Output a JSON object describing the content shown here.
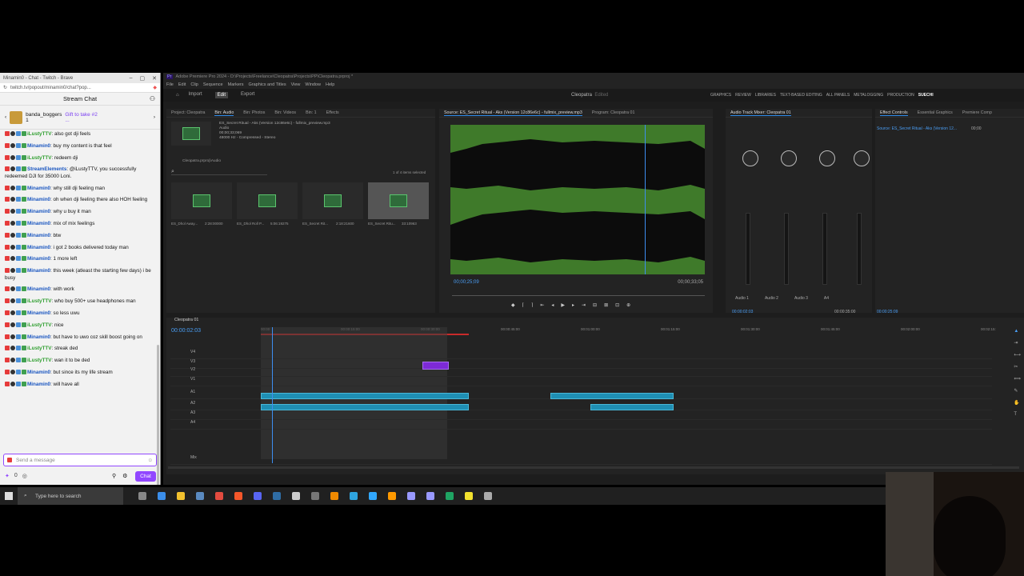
{
  "browser": {
    "tab_title": "Minamin0 - Chat - Twitch - Brave",
    "url": "twitch.tv/popout/minamin0/chat?pop..."
  },
  "chat": {
    "header": "Stream Chat",
    "banner": {
      "user": "banda_boggers",
      "count": "1",
      "gift": "Gift to take #2",
      "dots": "..."
    },
    "messages": [
      {
        "user": "iLustyTTV",
        "color": "#2e9e2e",
        "text": "also got dji feels"
      },
      {
        "user": "Minamin0",
        "color": "#1a56c0",
        "text": "buy my content is that feel"
      },
      {
        "user": "iLustyTTV",
        "color": "#2e9e2e",
        "text": "redeem dji"
      },
      {
        "user": "StreamElements",
        "color": "#1a56c0",
        "text": "@iLustyTTV, you successfully redeemed DJI for 35000 Loni."
      },
      {
        "user": "Minamin0",
        "color": "#1a56c0",
        "text": "why still dji feeling man"
      },
      {
        "user": "Minamin0",
        "color": "#1a56c0",
        "text": "oh when dji feeling there also HOH feeling"
      },
      {
        "user": "Minamin0",
        "color": "#1a56c0",
        "text": "why u buy it man"
      },
      {
        "user": "Minamin0",
        "color": "#1a56c0",
        "text": "mix of mix feelings"
      },
      {
        "user": "Minamin0",
        "color": "#1a56c0",
        "text": "btw"
      },
      {
        "user": "Minamin0",
        "color": "#1a56c0",
        "text": "i got 2 books delivered today man"
      },
      {
        "user": "Minamin0",
        "color": "#1a56c0",
        "text": "1 more left"
      },
      {
        "user": "Minamin0",
        "color": "#1a56c0",
        "text": "this week (atleast the starting few days) i be busy"
      },
      {
        "user": "Minamin0",
        "color": "#1a56c0",
        "text": "with work"
      },
      {
        "user": "iLustyTTV",
        "color": "#2e9e2e",
        "text": "who buy 500+ use headphones man"
      },
      {
        "user": "Minamin0",
        "color": "#1a56c0",
        "text": "so less uwu"
      },
      {
        "user": "iLustyTTV",
        "color": "#2e9e2e",
        "text": "nice"
      },
      {
        "user": "Minamin0",
        "color": "#1a56c0",
        "text": "but have to uwo coz skill boost going on"
      },
      {
        "user": "iLustyTTV",
        "color": "#2e9e2e",
        "text": "streak ded"
      },
      {
        "user": "iLustyTTV",
        "color": "#2e9e2e",
        "text": "wan it to be ded"
      },
      {
        "user": "Minamin0",
        "color": "#1a56c0",
        "text": "but since its my life stream"
      },
      {
        "user": "Minamin0",
        "color": "#1a56c0",
        "text": "will have all"
      }
    ],
    "input_placeholder": "Send a message",
    "points": "0",
    "chat_button": "Chat"
  },
  "premiere": {
    "title": "Adobe Premiere Pro 2024 - D:\\Projects\\Freelance\\Cleopatra\\Projects\\PP\\Cleopatra.prproj *",
    "menu": [
      "File",
      "Edit",
      "Clip",
      "Sequence",
      "Markers",
      "Graphics and Titles",
      "View",
      "Window",
      "Help"
    ],
    "tabs": [
      "Import",
      "Edit",
      "Export"
    ],
    "center_title": "Cleopatra",
    "center_sub": "Edited",
    "workspaces": [
      "GRAPHICS",
      "REVIEW",
      "LIBRARIES",
      "TEXT-BASED EDITING",
      "ALL PANELS",
      "METALOGGING",
      "PRODUCTION",
      "SUECHI"
    ],
    "project": {
      "tabs": [
        "Project: Cleopatra",
        "Bin: Audio",
        "Bin: Photos",
        "Bin: Videos",
        "Bin: 1",
        "Effects"
      ],
      "preview_name": "ES_Secret Ritual - Aks (Version 12c86e6c) - fullmix_preview.mp3",
      "preview_type": "Audio",
      "preview_dur": "00;00;33;069",
      "preview_rate": "48000 Hz - Compressed - Stereo",
      "path": "Cleopatra.prproj\\Audio",
      "selected": "1 of 4 items selected",
      "items": [
        {
          "name": "ES_Dhol Away...",
          "dur": "2:28:00000"
        },
        {
          "name": "ES_Dhol Roll P...",
          "dur": "5:06:19275"
        },
        {
          "name": "ES_Secret Rit...",
          "dur": "2:18:21600"
        },
        {
          "name": "ES_Secret Ritu...",
          "dur": "33:10963"
        }
      ]
    },
    "source": {
      "tab": "Source: ES_Secret Ritual - Aks (Version 12c86e6c) - fullmix_preview.mp3",
      "program": "Program: Cleopatra 01",
      "tc_left": "00;00;25;09",
      "tc_right": "00;00;33;05"
    },
    "mixer": {
      "tab": "Audio Track Mixer: Cleopatra 01",
      "channels": [
        "Audio 1",
        "Audio 2",
        "Audio 3",
        "A4"
      ],
      "mode": "Read",
      "tc_left": "00:00:02:03",
      "tc_right": "00:00:35:00"
    },
    "effects": {
      "tabs": [
        "Effect Controls",
        "Essential Graphics",
        "Premiere Comp"
      ],
      "source": "Source: ES_Secret Ritual - Aks (Version 12...",
      "tc": "00:00:25:09",
      "tc2": "00;00"
    },
    "timeline": {
      "seq": "Cleopatra 01",
      "tc": "00:00:02:03",
      "ruler": [
        "00:00",
        "00:00:15:00",
        "00:00:30:00",
        "00:00:45:00",
        "00:01:00:00",
        "00:01:15:00",
        "00:01:30:00",
        "00:01:45:00",
        "00:02:00:00",
        "00:02:15:"
      ],
      "tracks": [
        "V4",
        "V3",
        "V2",
        "V1",
        "A1",
        "A2",
        "A3",
        "A4",
        "Mix"
      ],
      "audio3": "Audio 3",
      "mix": "0.0"
    }
  },
  "taskbar": {
    "search": "Type here to search"
  }
}
